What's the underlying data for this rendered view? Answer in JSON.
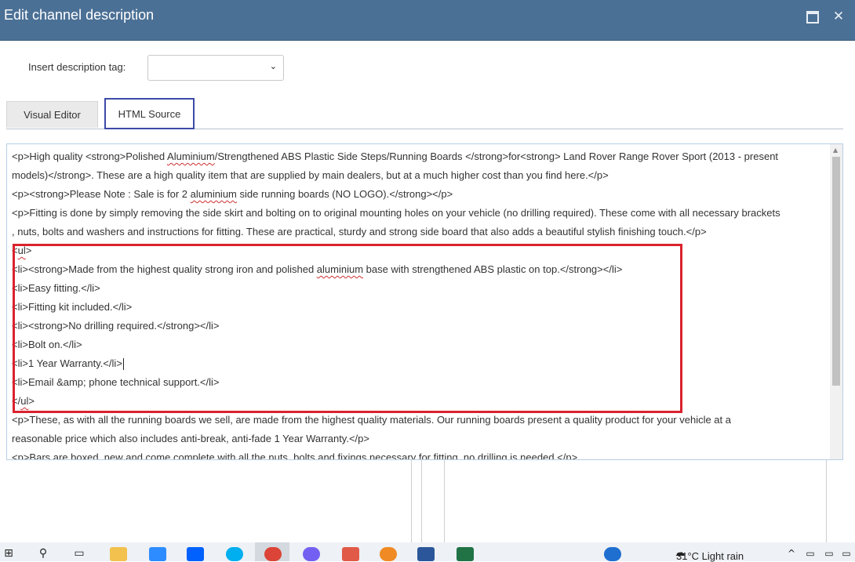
{
  "window": {
    "title": "Edit channel description"
  },
  "toolbar": {
    "insert_tag_label": "Insert description tag:",
    "insert_tag_value": ""
  },
  "tabs": [
    {
      "label": "Visual Editor",
      "active": false
    },
    {
      "label": "HTML Source",
      "active": true
    }
  ],
  "editor": {
    "lines": [
      "<p>High quality <strong>Polished Aluminium/Strengthened ABS Plastic Side Steps/Running Boards </strong>for<strong> Land Rover Range Rover Sport (2013 - present",
      "models)</strong>. These are a high quality item that are supplied by main dealers, but at a much higher cost than you find here.</p>",
      "<p><strong>Please Note : Sale is for 2 aluminium side running boards (NO LOGO).</strong></p>",
      "<p>Fitting is done by simply removing the side skirt and bolting on to original mounting holes on your vehicle (no drilling required). These come with all necessary brackets",
      ", nuts, bolts and washers and instructions for fitting. These are practical, sturdy and strong side board that also adds a beautiful stylish finishing touch.</p>",
      "<ul>",
      "<li><strong>Made from the highest quality strong iron and polished aluminium base with strengthened ABS plastic on top.</strong></li>",
      "<li>Easy fitting.</li>",
      "<li>Fitting kit included.</li>",
      "<li><strong>No drilling required.</strong></li>",
      "<li>Bolt on.</li>",
      "<li>1 Year Warranty.</li>",
      "<li>Email &amp; phone technical support.</li>",
      "</ul>",
      "<p>These, as with all the running boards we sell, are made from the highest quality materials. Our running boards present a quality product for your vehicle at a",
      "reasonable price which also includes anti-break, anti-fade 1 Year Warranty.</p>",
      "<p>Bars are boxed, new and come complete with all the nuts, bolts and fixings necessary for fitting, no drilling is needed.</p>"
    ],
    "highlight_color": "#d9232e"
  },
  "taskbar": {
    "weather": "31°C  Light rain"
  },
  "colors": {
    "titlebar": "#4b7095",
    "tab_active_border": "#3c4aa8"
  }
}
